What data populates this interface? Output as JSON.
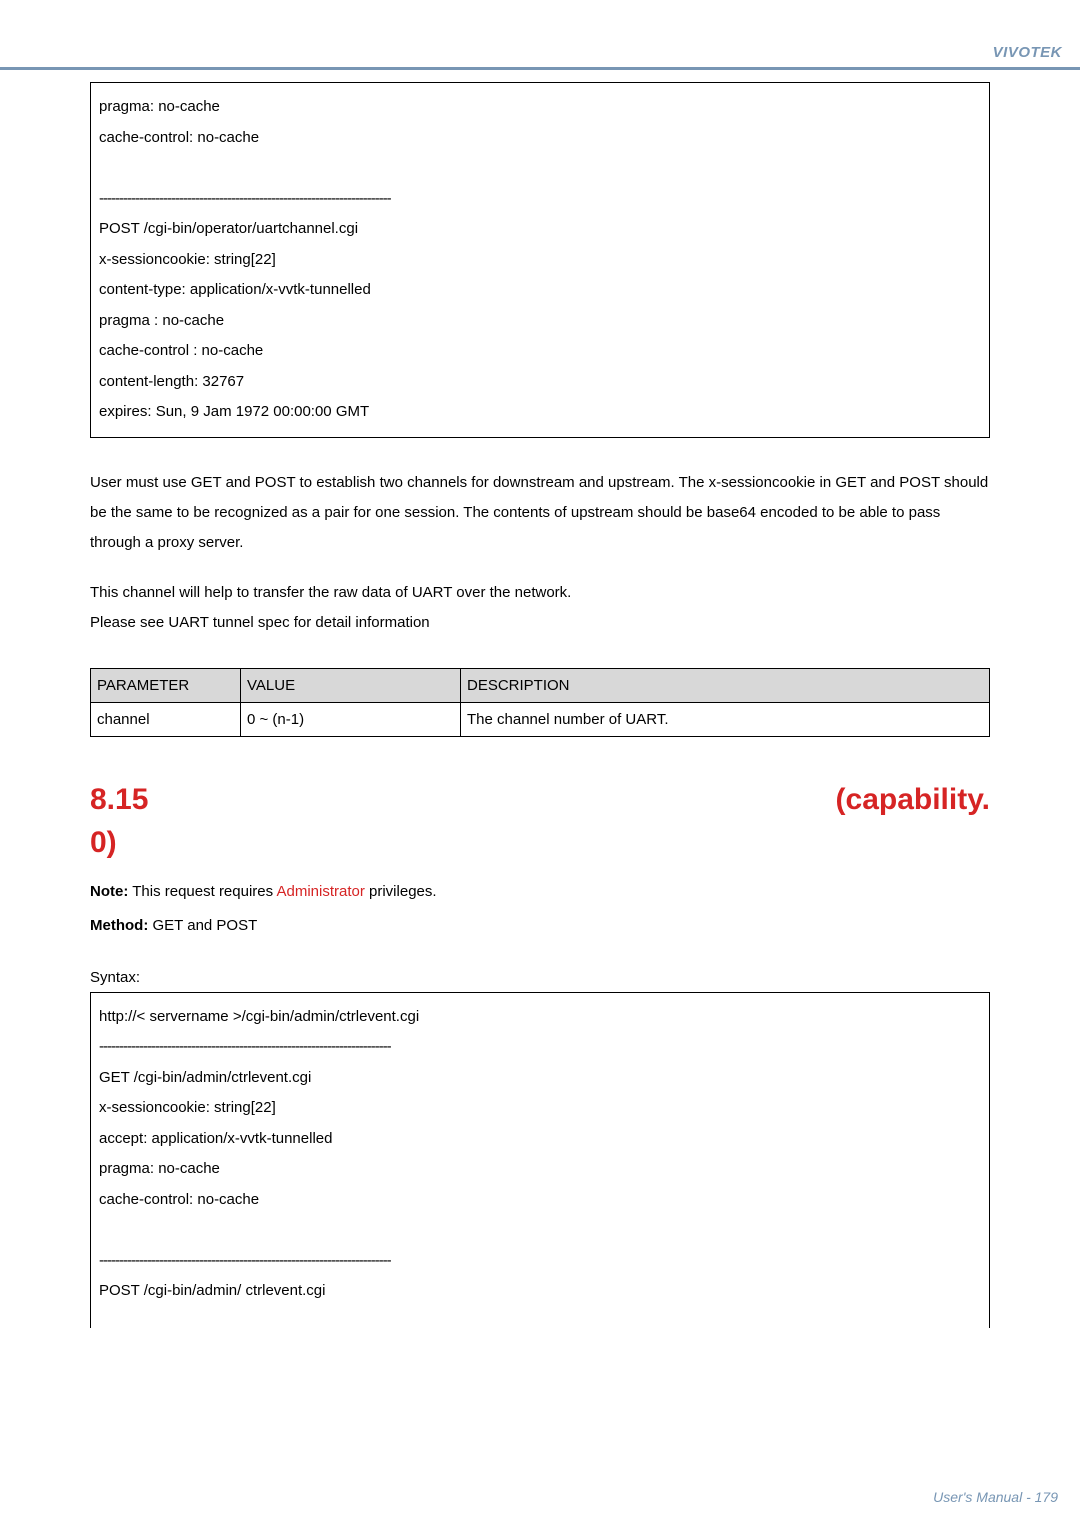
{
  "brand": "VIVOTEK",
  "box1": {
    "l1": "pragma: no-cache",
    "l2": "cache-control: no-cache",
    "sep": "-------------------------------------------------------------------------",
    "l3": "POST /cgi-bin/operator/uartchannel.cgi",
    "l4": "x-sessioncookie: string[22]",
    "l5": "content-type: application/x-vvtk-tunnelled",
    "l6": "pragma : no-cache",
    "l7": "cache-control : no-cache",
    "l8": "content-length: 32767",
    "l9": "expires: Sun, 9 Jam 1972 00:00:00 GMT"
  },
  "para1": "User must use GET and POST to establish two channels for downstream and upstream. The x-sessioncookie in GET and POST should be the same to be recognized          as a pair for one session. The contents of upstream should be base64 encoded to be able to pass through a proxy server.",
  "para2a": "This channel will help to transfer the raw data of UART over the network.",
  "para2b": "Please see UART tunnel spec for detail information",
  "table": {
    "h1": "PARAMETER",
    "h2": "VALUE",
    "h3": "DESCRIPTION",
    "r1c1": "channel",
    "r1c2": "0 ~ (n-1)",
    "r1c3": "The channel number of UART."
  },
  "section_title_left": "8.15",
  "section_title_right": "(capability.",
  "section_title2": "0)",
  "note": {
    "prefix": "Note:",
    "mid1": "  This request requires   ",
    "admin": "Administrator",
    "mid2": "   privileges.",
    "method_label": "Method:",
    "method_value": "   GET and POST"
  },
  "syntax_label": "Syntax:",
  "box2": {
    "l1": "http://<   servername   >/cgi-bin/admin/ctrlevent.cgi",
    "sep1": "-------------------------------------------------------------------------",
    "l2": "GET /cgi-bin/admin/ctrlevent.cgi",
    "l3": "x-sessioncookie: string[22]",
    "l4": "accept: application/x-vvtk-tunnelled",
    "l5": "pragma: no-cache",
    "l6": "cache-control: no-cache",
    "sep2": "-------------------------------------------------------------------------",
    "l7": "POST /cgi-bin/admin/ ctrlevent.cgi"
  },
  "footer": "User's Manual - 179"
}
